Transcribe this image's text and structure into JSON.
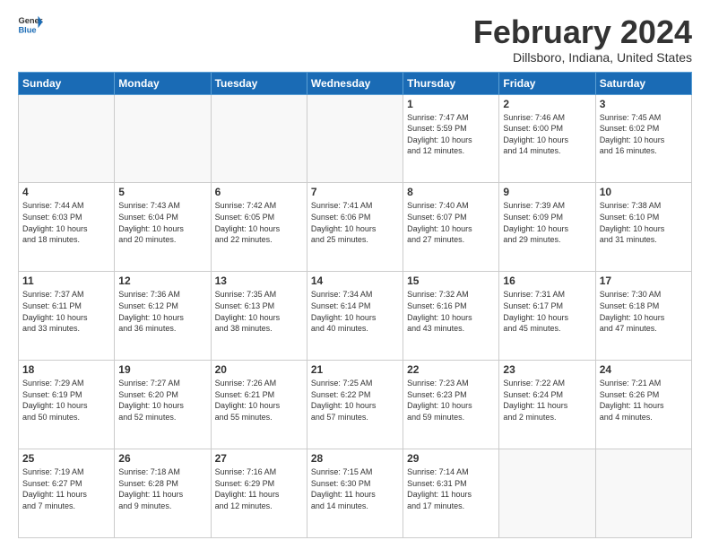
{
  "header": {
    "logo": {
      "general": "General",
      "blue": "Blue"
    },
    "title": "February 2024",
    "location": "Dillsboro, Indiana, United States"
  },
  "calendar": {
    "weekdays": [
      "Sunday",
      "Monday",
      "Tuesday",
      "Wednesday",
      "Thursday",
      "Friday",
      "Saturday"
    ],
    "weeks": [
      [
        {
          "day": "",
          "info": ""
        },
        {
          "day": "",
          "info": ""
        },
        {
          "day": "",
          "info": ""
        },
        {
          "day": "",
          "info": ""
        },
        {
          "day": "1",
          "info": "Sunrise: 7:47 AM\nSunset: 5:59 PM\nDaylight: 10 hours\nand 12 minutes."
        },
        {
          "day": "2",
          "info": "Sunrise: 7:46 AM\nSunset: 6:00 PM\nDaylight: 10 hours\nand 14 minutes."
        },
        {
          "day": "3",
          "info": "Sunrise: 7:45 AM\nSunset: 6:02 PM\nDaylight: 10 hours\nand 16 minutes."
        }
      ],
      [
        {
          "day": "4",
          "info": "Sunrise: 7:44 AM\nSunset: 6:03 PM\nDaylight: 10 hours\nand 18 minutes."
        },
        {
          "day": "5",
          "info": "Sunrise: 7:43 AM\nSunset: 6:04 PM\nDaylight: 10 hours\nand 20 minutes."
        },
        {
          "day": "6",
          "info": "Sunrise: 7:42 AM\nSunset: 6:05 PM\nDaylight: 10 hours\nand 22 minutes."
        },
        {
          "day": "7",
          "info": "Sunrise: 7:41 AM\nSunset: 6:06 PM\nDaylight: 10 hours\nand 25 minutes."
        },
        {
          "day": "8",
          "info": "Sunrise: 7:40 AM\nSunset: 6:07 PM\nDaylight: 10 hours\nand 27 minutes."
        },
        {
          "day": "9",
          "info": "Sunrise: 7:39 AM\nSunset: 6:09 PM\nDaylight: 10 hours\nand 29 minutes."
        },
        {
          "day": "10",
          "info": "Sunrise: 7:38 AM\nSunset: 6:10 PM\nDaylight: 10 hours\nand 31 minutes."
        }
      ],
      [
        {
          "day": "11",
          "info": "Sunrise: 7:37 AM\nSunset: 6:11 PM\nDaylight: 10 hours\nand 33 minutes."
        },
        {
          "day": "12",
          "info": "Sunrise: 7:36 AM\nSunset: 6:12 PM\nDaylight: 10 hours\nand 36 minutes."
        },
        {
          "day": "13",
          "info": "Sunrise: 7:35 AM\nSunset: 6:13 PM\nDaylight: 10 hours\nand 38 minutes."
        },
        {
          "day": "14",
          "info": "Sunrise: 7:34 AM\nSunset: 6:14 PM\nDaylight: 10 hours\nand 40 minutes."
        },
        {
          "day": "15",
          "info": "Sunrise: 7:32 AM\nSunset: 6:16 PM\nDaylight: 10 hours\nand 43 minutes."
        },
        {
          "day": "16",
          "info": "Sunrise: 7:31 AM\nSunset: 6:17 PM\nDaylight: 10 hours\nand 45 minutes."
        },
        {
          "day": "17",
          "info": "Sunrise: 7:30 AM\nSunset: 6:18 PM\nDaylight: 10 hours\nand 47 minutes."
        }
      ],
      [
        {
          "day": "18",
          "info": "Sunrise: 7:29 AM\nSunset: 6:19 PM\nDaylight: 10 hours\nand 50 minutes."
        },
        {
          "day": "19",
          "info": "Sunrise: 7:27 AM\nSunset: 6:20 PM\nDaylight: 10 hours\nand 52 minutes."
        },
        {
          "day": "20",
          "info": "Sunrise: 7:26 AM\nSunset: 6:21 PM\nDaylight: 10 hours\nand 55 minutes."
        },
        {
          "day": "21",
          "info": "Sunrise: 7:25 AM\nSunset: 6:22 PM\nDaylight: 10 hours\nand 57 minutes."
        },
        {
          "day": "22",
          "info": "Sunrise: 7:23 AM\nSunset: 6:23 PM\nDaylight: 10 hours\nand 59 minutes."
        },
        {
          "day": "23",
          "info": "Sunrise: 7:22 AM\nSunset: 6:24 PM\nDaylight: 11 hours\nand 2 minutes."
        },
        {
          "day": "24",
          "info": "Sunrise: 7:21 AM\nSunset: 6:26 PM\nDaylight: 11 hours\nand 4 minutes."
        }
      ],
      [
        {
          "day": "25",
          "info": "Sunrise: 7:19 AM\nSunset: 6:27 PM\nDaylight: 11 hours\nand 7 minutes."
        },
        {
          "day": "26",
          "info": "Sunrise: 7:18 AM\nSunset: 6:28 PM\nDaylight: 11 hours\nand 9 minutes."
        },
        {
          "day": "27",
          "info": "Sunrise: 7:16 AM\nSunset: 6:29 PM\nDaylight: 11 hours\nand 12 minutes."
        },
        {
          "day": "28",
          "info": "Sunrise: 7:15 AM\nSunset: 6:30 PM\nDaylight: 11 hours\nand 14 minutes."
        },
        {
          "day": "29",
          "info": "Sunrise: 7:14 AM\nSunset: 6:31 PM\nDaylight: 11 hours\nand 17 minutes."
        },
        {
          "day": "",
          "info": ""
        },
        {
          "day": "",
          "info": ""
        }
      ]
    ]
  }
}
